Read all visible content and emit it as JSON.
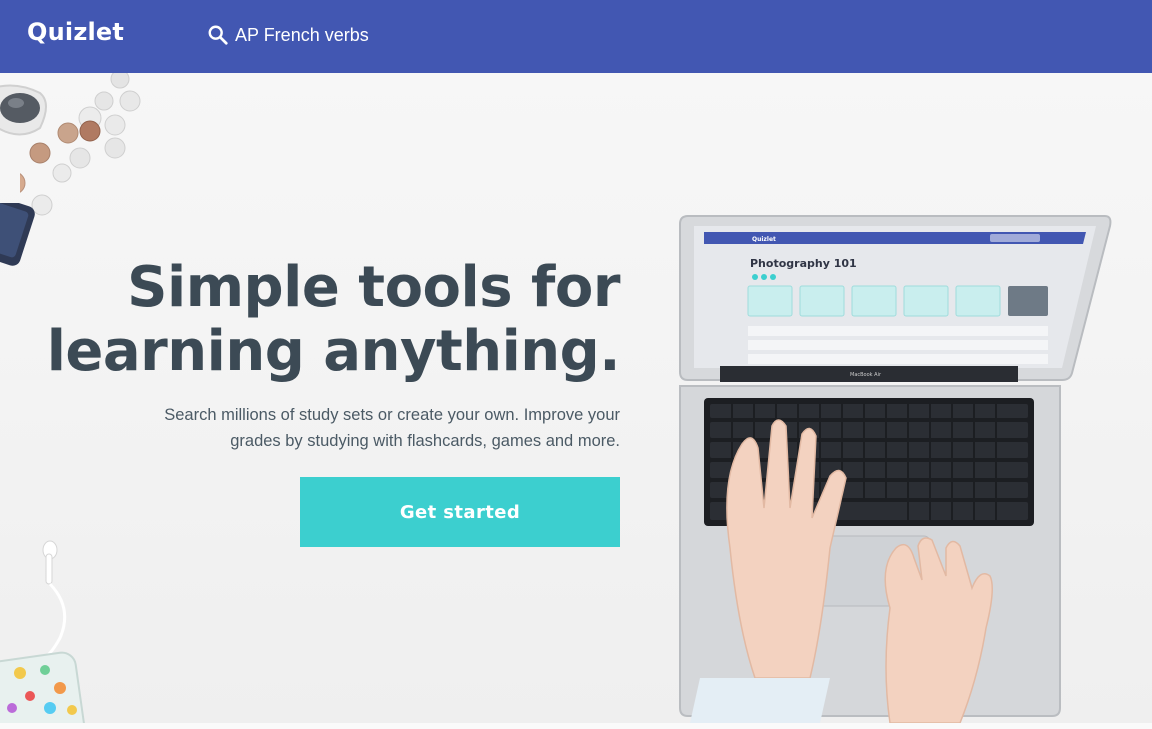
{
  "header": {
    "logo": "Quizlet",
    "search": {
      "placeholder": "AP French verbs",
      "icon": "search-icon"
    },
    "background_color": "#4257b2"
  },
  "hero": {
    "headline_line1": "Simple tools for",
    "headline_line2": "learning anything.",
    "subtext_line1": "Search millions of study sets or create your own. Improve your",
    "subtext_line2": "grades by studying with flashcards, games and more.",
    "cta_label": "Get started",
    "cta_color": "#3ccfcf"
  },
  "laptop_screen": {
    "brand": "Quizlet",
    "set_title": "Photography 101",
    "laptop_label": "MacBook Air"
  }
}
